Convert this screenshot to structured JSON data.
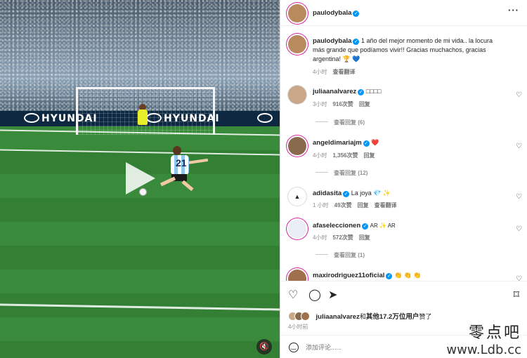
{
  "post": {
    "author": "paulodybala",
    "caption": "1 año del mejor momento de mi vida.. la locura más grande que podíamos vivir!! Gracias muchachos, gracias argentina! 🏆 💙",
    "caption_time": "4小时",
    "see_translation": "查看翻译"
  },
  "video": {
    "sponsor_logo": "HYUNDAI",
    "mute_icon": "speaker-muted-icon"
  },
  "comments": [
    {
      "user": "juliaanalvarez",
      "text": "□□□□",
      "time": "3小时",
      "likes": "916次赞",
      "reply": "回复",
      "more_replies": "查看回复 (6)"
    },
    {
      "user": "angeldimariajm",
      "text": "❤️",
      "time": "4小时",
      "likes": "1,356次赞",
      "reply": "回复",
      "more_replies": "查看回复 (12)"
    },
    {
      "user": "adidasita",
      "text": "La joya 💎 ✨",
      "time": "1 小时",
      "likes": "49次赞",
      "reply": "回复",
      "translate": "查看翻译"
    },
    {
      "user": "afaseleccionen",
      "text": "AR ✨ AR",
      "time": "4小时",
      "likes": "572次赞",
      "reply": "回复",
      "more_replies": "查看回复 (1)"
    },
    {
      "user": "maxirodriguez11oficial",
      "text": "👏 👏 👏"
    }
  ],
  "likes_summary": {
    "first_user": "juliaanalvarez",
    "connector": "和",
    "others": "其他17.2万位用户",
    "suffix": "赞了"
  },
  "post_time": "4小时前",
  "add_comment": {
    "placeholder": "添加评论......"
  },
  "watermark": {
    "cn": "零点吧",
    "url": "www.Ldb.cc"
  },
  "colors": {
    "verified": "#0095f6",
    "story_ring": "#d6249f",
    "muted_text": "#8e8e8e"
  }
}
